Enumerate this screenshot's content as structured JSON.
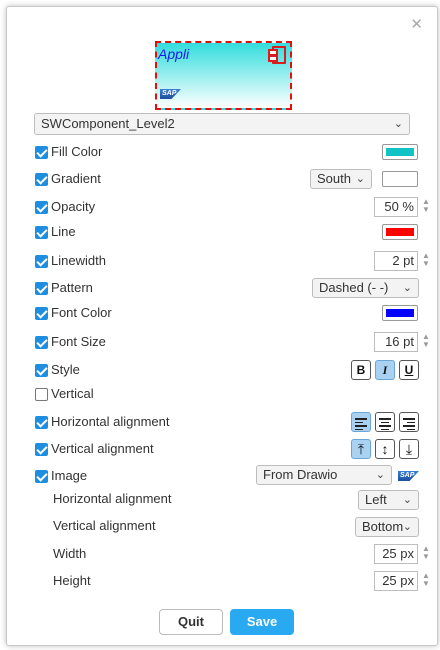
{
  "preview": {
    "text": "Appli",
    "logo": "SAP"
  },
  "shape_select": {
    "value": "SWComponent_Level2"
  },
  "rows": {
    "fill_color": {
      "label": "Fill Color",
      "checked": true,
      "color": "#11c3c3"
    },
    "gradient": {
      "label": "Gradient",
      "checked": true,
      "direction": "South",
      "color": "#ffffff"
    },
    "opacity": {
      "label": "Opacity",
      "checked": true,
      "value": "50 %"
    },
    "line": {
      "label": "Line",
      "checked": true,
      "color": "#ff0000"
    },
    "linewidth": {
      "label": "Linewidth",
      "checked": true,
      "value": "2 pt"
    },
    "pattern": {
      "label": "Pattern",
      "checked": true,
      "value": "Dashed (- -)"
    },
    "font_color": {
      "label": "Font Color",
      "checked": true,
      "color": "#0000ff"
    },
    "font_size": {
      "label": "Font Size",
      "checked": true,
      "value": "16 pt"
    },
    "style": {
      "label": "Style",
      "checked": true,
      "bold": "B",
      "italic": "I",
      "underline": "U"
    },
    "vertical": {
      "label": "Vertical",
      "checked": false
    },
    "horizontal_alignment": {
      "label": "Horizontal alignment",
      "checked": true
    },
    "vertical_alignment": {
      "label": "Vertical alignment",
      "checked": true
    },
    "image": {
      "label": "Image",
      "checked": true,
      "source": "From Drawio",
      "logo": "SAP"
    }
  },
  "image_options": {
    "h_align": {
      "label": "Horizontal alignment",
      "value": "Left"
    },
    "v_align": {
      "label": "Vertical alignment",
      "value": "Bottom"
    },
    "width": {
      "label": "Width",
      "value": "25 px"
    },
    "height": {
      "label": "Height",
      "value": "25 px"
    }
  },
  "buttons": {
    "quit": "Quit",
    "save": "Save"
  },
  "icons": {
    "close": "close-icon",
    "chevron": "chevron-down-icon",
    "spinner": "spinner-icon"
  }
}
